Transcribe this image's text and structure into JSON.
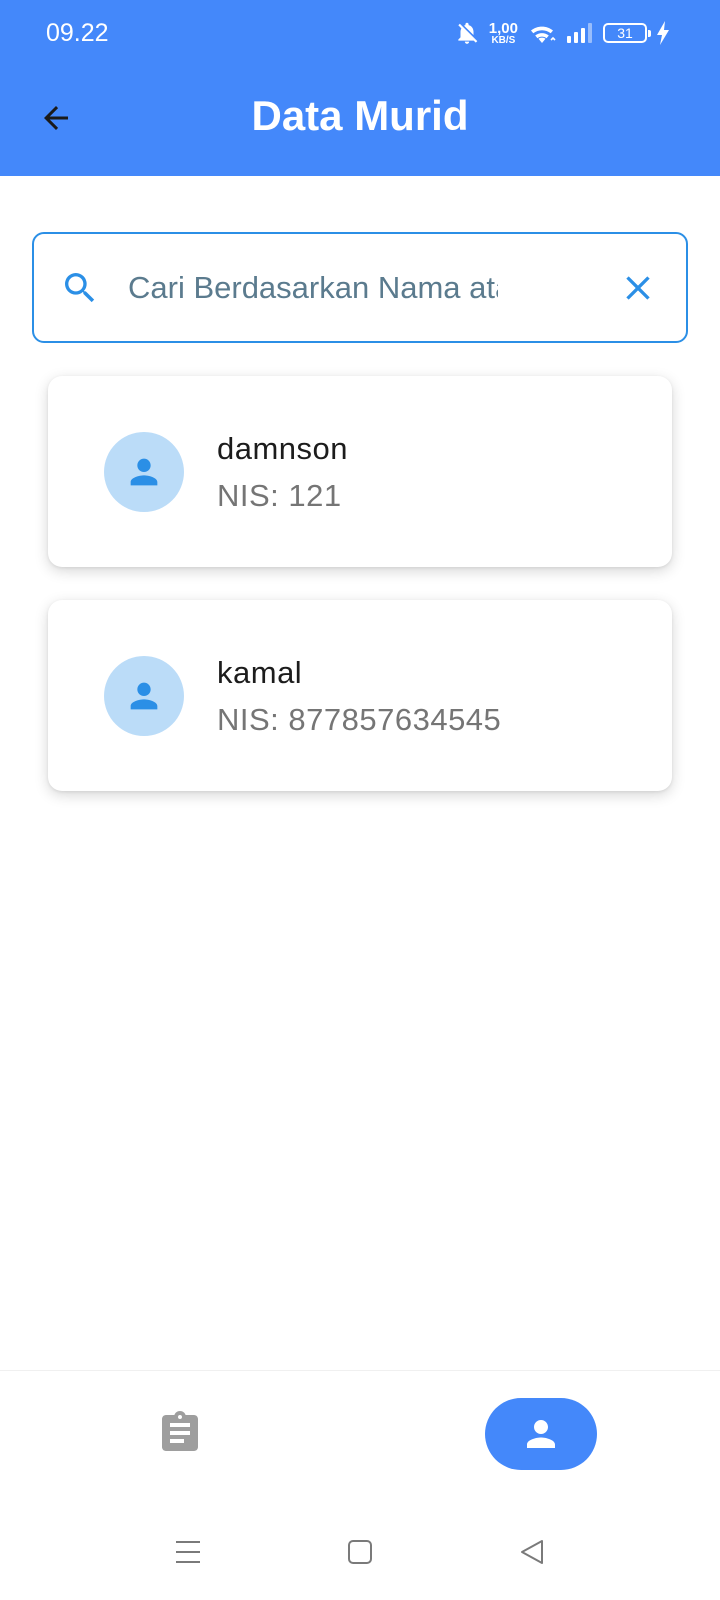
{
  "status_bar": {
    "time": "09.22",
    "network_speed": "1,00",
    "network_unit": "KB/S",
    "battery": "31"
  },
  "header": {
    "title": "Data Murid",
    "back_icon": "arrow-left-icon"
  },
  "search": {
    "placeholder": "Cari Berdasarkan Nama atau NIS",
    "value": "",
    "search_icon": "search-icon",
    "clear_icon": "close-icon"
  },
  "students": [
    {
      "name": "damnson",
      "nis": "NIS: 121"
    },
    {
      "name": "kamal",
      "nis": "NIS: 877857634545"
    }
  ],
  "bottom_nav": {
    "tabs": [
      {
        "icon": "clipboard-icon",
        "active": false
      },
      {
        "icon": "person-icon",
        "active": true
      }
    ]
  },
  "colors": {
    "primary": "#4488fa",
    "accent": "#2b8fe6",
    "avatar_bg": "#bbdcf8",
    "nis_text": "#757575"
  }
}
